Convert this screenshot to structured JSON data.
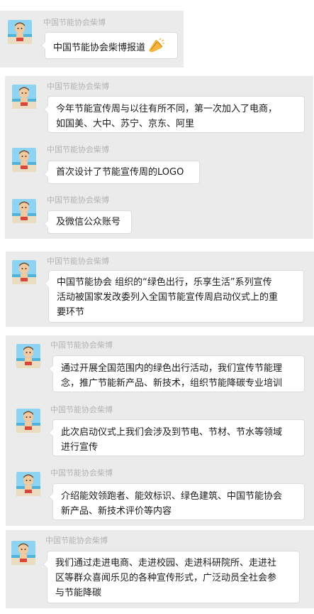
{
  "sender_name": "中国节能协会柴博",
  "messages": [
    {
      "text": "中国节能协会柴博报道",
      "emoji": "clapping-hands-emoji"
    },
    {
      "text": "今年节能宣传周与以往有所不同，第一次加入了电商，\n如国美、大中、苏宁、京东、阿里"
    },
    {
      "text": "首次设计了节能宣传周的LOGO"
    },
    {
      "text": "及微信公众账号"
    },
    {
      "text": "中国节能协会 组织的“绿色出行，乐享生活”系列宣传\n活动被国家发改委列入全国节能宣传周启动仪式上的重\n要环节"
    },
    {
      "text": "通过开展全国范围内的绿色出行活动，我们宣传节能理\n念，推广节能新产品、新技术，组织节能降碳专业培训"
    },
    {
      "text": "此次启动仪式上我们会涉及到节电、节材、节水等领域\n进行宣传"
    },
    {
      "text": "介绍能效领跑者、能效标识、绿色建筑、中国节能协会\n新产品、新技术评价等内容"
    },
    {
      "text": "我们通过走进电商、走进校园、走进科研院所、走进社\n区等群众喜闻乐见的各种宣传形式，广泛动员全社会参\n与节能降碳"
    }
  ]
}
